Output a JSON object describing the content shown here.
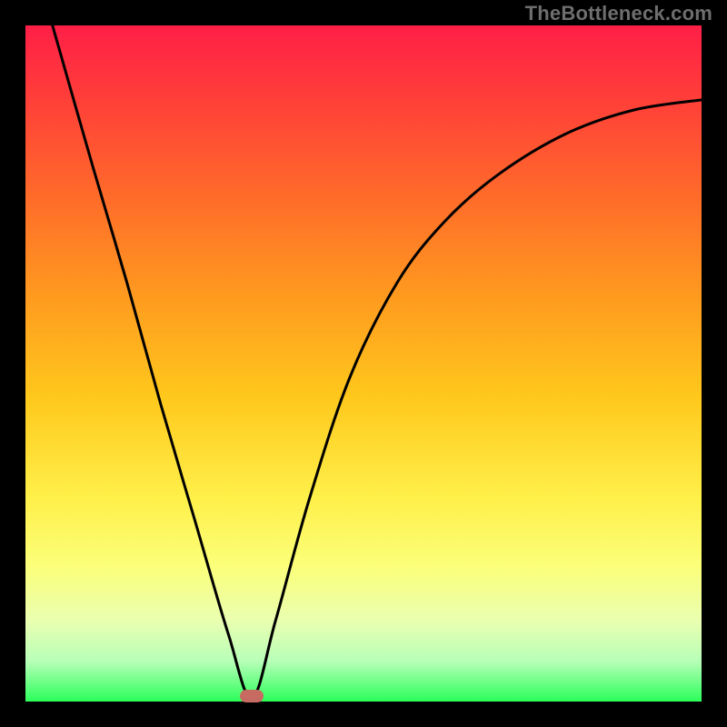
{
  "watermark": "TheBottleneck.com",
  "chart_data": {
    "type": "line",
    "title": "",
    "xlabel": "",
    "ylabel": "",
    "xlim": [
      0,
      100
    ],
    "ylim": [
      0,
      100
    ],
    "grid": false,
    "legend": false,
    "series": [
      {
        "name": "curve",
        "x": [
          4,
          10,
          15,
          20,
          25,
          30,
          33.5,
          37,
          42,
          48,
          55,
          62,
          70,
          80,
          90,
          100
        ],
        "values": [
          100,
          79,
          62,
          44,
          27,
          10,
          0.5,
          12,
          30,
          48,
          62,
          71,
          78,
          84,
          87.5,
          89
        ]
      }
    ],
    "marker": {
      "x": 33.5,
      "y": 0.5,
      "color": "#c66a62"
    },
    "background_gradient": {
      "top": "#ff1f47",
      "mid": "#ffd23a",
      "bottom": "#2bff5a"
    }
  }
}
